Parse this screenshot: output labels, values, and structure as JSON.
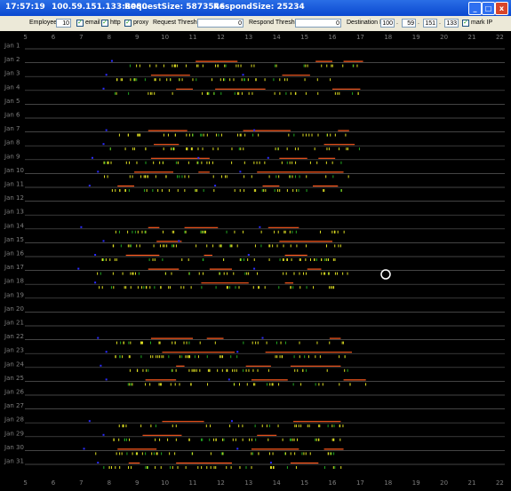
{
  "window": {
    "time": "17:57:19",
    "host": "100.59.151.133:8080",
    "request_size": "RequestSize: 5873546",
    "respond_size": "RespondSize: 25234",
    "controls": {
      "minimize": "_",
      "maximize": "□",
      "close": "x"
    }
  },
  "toolbar": {
    "employee_label": "Employee",
    "employee_value": "10",
    "email_label": "email",
    "email_checked": true,
    "http_label": "http",
    "http_checked": true,
    "proxy_label": "proxy",
    "proxy_checked": true,
    "request_threshold_label": "Request Threshold",
    "request_threshold_value": "0",
    "respond_threshold_label": "Respond Threshold",
    "respond_threshold_value": "0",
    "destination_ip_label": "Destination IP",
    "ip_octets": [
      "100",
      "59",
      "151",
      "133"
    ],
    "ip_separator": ".",
    "mark_ip_label": "mark IP",
    "mark_ip_checked": true
  },
  "colors": {
    "background": "#000000",
    "row_line": "#5a5a5a",
    "axis_text": "#7f7f7f",
    "email": "#2b2bff",
    "http": "#dddd22",
    "proxy": "#22aa22",
    "session": "#ff5a1e"
  },
  "axis": {
    "hour_ticks": [
      "5",
      "6",
      "7",
      "8",
      "9",
      "10",
      "11",
      "12",
      "13",
      "14",
      "15",
      "16",
      "17",
      "18",
      "19",
      "20",
      "21",
      "22"
    ]
  },
  "days": [
    {
      "label": "Jan 1",
      "active": false
    },
    {
      "label": "Jan 2",
      "active": true,
      "email": [
        8.1
      ],
      "sessions": [
        [
          11.1,
          12.6
        ],
        [
          15.4,
          16.0
        ],
        [
          16.4,
          17.1
        ]
      ],
      "start": 8.3,
      "end": 17.0
    },
    {
      "label": "Jan 3",
      "active": true,
      "email": [
        7.9,
        12.8
      ],
      "sessions": [
        [
          9.5,
          10.9
        ],
        [
          14.2,
          15.2
        ]
      ],
      "start": 8.2,
      "end": 16.8
    },
    {
      "label": "Jan 4",
      "active": true,
      "email": [
        7.8
      ],
      "sessions": [
        [
          10.4,
          11.0
        ],
        [
          11.8,
          13.6
        ],
        [
          16.0,
          17.0
        ]
      ],
      "start": 8.0,
      "end": 17.0
    },
    {
      "label": "Jan 5",
      "active": false
    },
    {
      "label": "Jan 6",
      "active": false
    },
    {
      "label": "Jan 7",
      "active": true,
      "email": [
        7.9,
        13.2
      ],
      "sessions": [
        [
          9.4,
          10.8
        ],
        [
          12.8,
          14.5
        ],
        [
          16.2,
          16.6
        ]
      ],
      "start": 7.9,
      "end": 16.8
    },
    {
      "label": "Jan 8",
      "active": true,
      "email": [
        7.8
      ],
      "sessions": [
        [
          9.6,
          10.5
        ],
        [
          15.7,
          16.8
        ]
      ],
      "start": 8.0,
      "end": 17.0
    },
    {
      "label": "Jan 9",
      "active": true,
      "email": [
        7.4,
        11.2,
        13.7
      ],
      "sessions": [
        [
          9.5,
          11.6
        ],
        [
          14.1,
          15.1
        ],
        [
          15.5,
          16.1
        ]
      ],
      "start": 7.8,
      "end": 16.6
    },
    {
      "label": "Jan 10",
      "active": true,
      "email": [
        7.6,
        12.7
      ],
      "sessions": [
        [
          8.9,
          10.3
        ],
        [
          11.2,
          11.6
        ],
        [
          13.3,
          16.4
        ]
      ],
      "start": 7.8,
      "end": 16.7
    },
    {
      "label": "Jan 11",
      "active": true,
      "email": [
        7.3,
        11.8
      ],
      "sessions": [
        [
          8.3,
          8.9
        ],
        [
          13.5,
          14.1
        ],
        [
          15.3,
          16.2
        ]
      ],
      "start": 7.5,
      "end": 16.5
    },
    {
      "label": "Jan 12",
      "active": false
    },
    {
      "label": "Jan 13",
      "active": false
    },
    {
      "label": "Jan 14",
      "active": true,
      "email": [
        7.0,
        13.4
      ],
      "sessions": [
        [
          9.4,
          9.8
        ],
        [
          10.7,
          11.9
        ],
        [
          13.7,
          14.8
        ]
      ],
      "start": 7.6,
      "end": 16.7
    },
    {
      "label": "Jan 15",
      "active": true,
      "email": [
        7.8,
        10.5
      ],
      "sessions": [
        [
          9.7,
          10.6
        ],
        [
          14.1,
          16.0
        ]
      ],
      "start": 7.9,
      "end": 16.5
    },
    {
      "label": "Jan 16",
      "active": true,
      "email": [
        7.5,
        13.0
      ],
      "sessions": [
        [
          8.6,
          9.8
        ],
        [
          11.4,
          11.7
        ],
        [
          14.3,
          15.1
        ]
      ],
      "start": 7.6,
      "end": 16.4
    },
    {
      "label": "Jan 17",
      "active": true,
      "email": [
        6.9,
        13.2
      ],
      "sessions": [
        [
          9.4,
          10.5
        ],
        [
          11.6,
          12.4
        ],
        [
          15.1,
          15.6
        ]
      ],
      "start": 7.5,
      "end": 16.7
    },
    {
      "label": "Jan 18",
      "active": true,
      "email": [
        7.5
      ],
      "sessions": [
        [
          11.3,
          13.0
        ],
        [
          14.3,
          14.6
        ]
      ],
      "start": 7.6,
      "end": 16.6
    },
    {
      "label": "Jan 19",
      "active": false
    },
    {
      "label": "Jan 20",
      "active": false
    },
    {
      "label": "Jan 21",
      "active": false
    },
    {
      "label": "Jan 22",
      "active": true,
      "email": [
        7.6,
        13.5
      ],
      "sessions": [
        [
          9.5,
          11.0
        ],
        [
          11.5,
          12.1
        ],
        [
          15.9,
          16.3
        ]
      ],
      "start": 8.2,
      "end": 16.5
    },
    {
      "label": "Jan 23",
      "active": true,
      "email": [
        7.9,
        12.6
      ],
      "sessions": [
        [
          9.9,
          12.5
        ],
        [
          13.6,
          16.7
        ]
      ],
      "start": 8.2,
      "end": 16.8
    },
    {
      "label": "Jan 24",
      "active": true,
      "email": [
        7.7
      ],
      "sessions": [
        [
          10.4,
          10.7
        ],
        [
          12.9,
          13.8
        ],
        [
          14.5,
          16.3
        ]
      ],
      "start": 8.0,
      "end": 16.6
    },
    {
      "label": "Jan 25",
      "active": true,
      "email": [
        7.9,
        12.3
      ],
      "sessions": [
        [
          9.3,
          10.4
        ],
        [
          13.1,
          14.4
        ],
        [
          16.4,
          17.2
        ]
      ],
      "start": 8.5,
      "end": 17.3
    },
    {
      "label": "Jan 26",
      "active": false
    },
    {
      "label": "Jan 27",
      "active": false
    },
    {
      "label": "Jan 28",
      "active": true,
      "email": [
        7.3,
        12.4
      ],
      "sessions": [
        [
          9.9,
          11.4
        ],
        [
          14.6,
          16.3
        ]
      ],
      "start": 8.1,
      "end": 16.6
    },
    {
      "label": "Jan 29",
      "active": true,
      "email": [
        7.8
      ],
      "sessions": [
        [
          9.2,
          10.6
        ],
        [
          13.3,
          14.0
        ]
      ],
      "start": 7.9,
      "end": 16.5
    },
    {
      "label": "Jan 30",
      "active": true,
      "email": [
        7.1,
        12.6
      ],
      "sessions": [
        [
          8.3,
          9.7
        ],
        [
          13.1,
          14.8
        ],
        [
          15.7,
          16.4
        ]
      ],
      "start": 7.5,
      "end": 16.5
    },
    {
      "label": "Jan 31",
      "active": true,
      "email": [
        7.6,
        13.8
      ],
      "sessions": [
        [
          8.7,
          9.1
        ],
        [
          10.4,
          12.4
        ],
        [
          14.5,
          15.5
        ]
      ],
      "start": 7.7,
      "end": 16.4
    }
  ]
}
